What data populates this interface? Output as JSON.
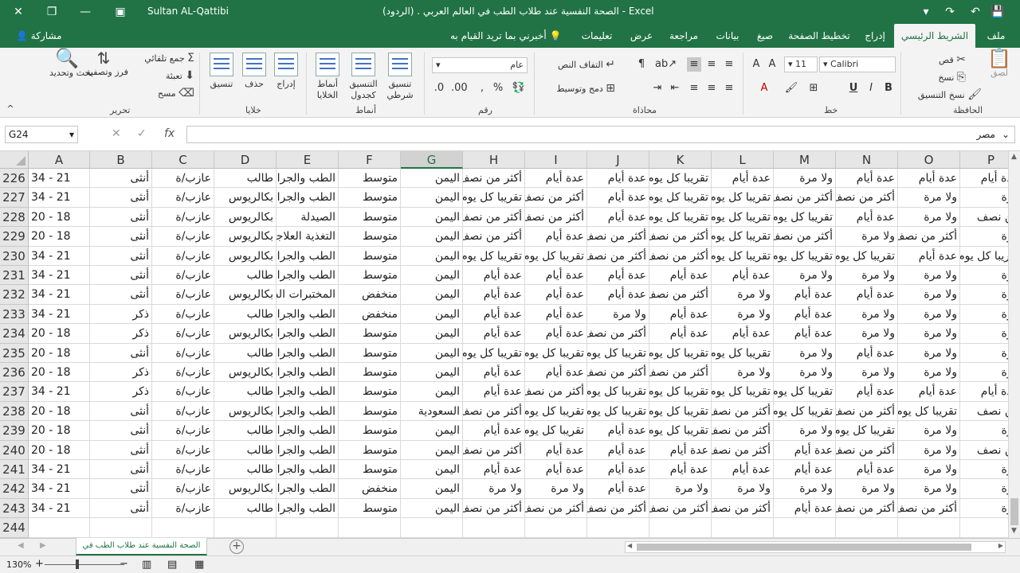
{
  "titlebar": {
    "user": "Sultan AL-Qattibi",
    "title": "الصحة النفسية عند طلاب الطب في العالم العربي .  (الردود)  -  Excel"
  },
  "tabs": {
    "file": "ملف",
    "home": "الشريط الرئيسي",
    "insert": "إدراج",
    "layout": "تخطيط الصفحة",
    "formulas": "صيغ",
    "data": "بيانات",
    "review": "مراجعة",
    "view": "عرض",
    "help": "تعليمات",
    "tellme": "أخبرني بما تريد القيام به",
    "share": "مشاركة"
  },
  "ribbon": {
    "clipboard": {
      "label": "الحافظة",
      "paste": "لصق",
      "cut": "قص",
      "copy": "نسخ",
      "format_painter": "نسخ التنسيق"
    },
    "font": {
      "label": "خط",
      "name": "Calibri",
      "size": "11",
      "bold": "B",
      "italic": "I",
      "underline": "U"
    },
    "alignment": {
      "label": "محاذاة",
      "wrap": "التفاف النص",
      "merge": "دمج وتوسيط"
    },
    "number": {
      "label": "رقم",
      "format": "عام"
    },
    "styles": {
      "label": "أنماط",
      "conditional": "تنسيق شرطي",
      "table": "التنسيق كجدول",
      "cell_styles": "أنماط الخلايا"
    },
    "cells": {
      "label": "خلايا",
      "insert": "إدراج",
      "delete": "حذف",
      "format": "تنسيق"
    },
    "editing": {
      "label": "تحرير",
      "autosum": "جمع تلقائي",
      "fill": "تعبئة",
      "clear": "مسح",
      "sort": "فرز وتصفية",
      "find": "بحث وتحديد"
    }
  },
  "formula_bar": {
    "name_box": "G24",
    "value": "مصر"
  },
  "columns": [
    "A",
    "B",
    "C",
    "D",
    "E",
    "F",
    "G",
    "H",
    "I",
    "J",
    "K",
    "L",
    "M",
    "N",
    "O",
    "P"
  ],
  "selected_column": "G",
  "rows": [
    {
      "n": "226",
      "c": [
        "34 - 21",
        "أنثى",
        "عازب/ة",
        "طالب",
        "الطب والجراحة",
        "متوسط",
        "اليمن",
        "أكثر من نصف",
        "عدة أيام",
        "عدة أيام",
        "تقريبا كل يوم",
        "عدة أيام",
        "ولا مرة",
        "عدة أيام",
        "عدة أيام",
        "عدة أيام"
      ]
    },
    {
      "n": "227",
      "c": [
        "34 - 21",
        "أنثى",
        "عازب/ة",
        "بكالريوس",
        "الطب والجراحة",
        "متوسط",
        "اليمن",
        "تقريبا كل يوم",
        "أكثر من نصف",
        "عدة أيام",
        "تقريبا كل يوم",
        "تقريبا كل يوم",
        "أكثر من نصف",
        "أكثر من نصف",
        "ولا مرة",
        "مرة"
      ]
    },
    {
      "n": "228",
      "c": [
        "20 - 18",
        "أنثى",
        "عازب/ة",
        "بكالريوس",
        "الصيدلة",
        "متوسط",
        "اليمن",
        "أكثر من نصف",
        "أكثر من نصف",
        "عدة أيام",
        "تقريبا كل يوم",
        "تقريبا كل يوم",
        "تقريبا كل يوم",
        "عدة أيام",
        "ولا مرة",
        "من نصف"
      ]
    },
    {
      "n": "229",
      "c": [
        "20 - 18",
        "أنثى",
        "عازب/ة",
        "بكالريوس",
        "التغذية العلاجية",
        "متوسط",
        "اليمن",
        "أكثر من نصف",
        "عدة أيام",
        "أكثر من نصف",
        "أكثر من نصف",
        "تقريبا كل يوم",
        "أكثر من نصف",
        "ولا مرة",
        "أكثر من نصف",
        "مرة"
      ]
    },
    {
      "n": "230",
      "c": [
        "34 - 21",
        "أنثى",
        "عازب/ة",
        "بكالريوس",
        "الطب والجراحة",
        "متوسط",
        "اليمن",
        "تقريبا كل يوم",
        "تقريبا كل يوم",
        "أكثر من نصف",
        "أكثر من نصف",
        "تقريبا كل يوم",
        "تقريبا كل يوم",
        "تقريبا كل يوم",
        "عدة أيام",
        "تقريبا كل يوم"
      ]
    },
    {
      "n": "231",
      "c": [
        "34 - 21",
        "أنثى",
        "عازب/ة",
        "طالب",
        "الطب والجراحة",
        "متوسط",
        "اليمن",
        "عدة أيام",
        "عدة أيام",
        "عدة أيام",
        "عدة أيام",
        "عدة أيام",
        "ولا مرة",
        "ولا مرة",
        "ولا مرة",
        "مرة"
      ]
    },
    {
      "n": "232",
      "c": [
        "34 - 21",
        "أنثى",
        "عازب/ة",
        "بكالريوس",
        "المختبرات الطبية",
        "منخفض",
        "اليمن",
        "عدة أيام",
        "عدة أيام",
        "عدة أيام",
        "أكثر من نصف",
        "ولا مرة",
        "عدة أيام",
        "عدة أيام",
        "ولا مرة",
        "مرة"
      ]
    },
    {
      "n": "233",
      "c": [
        "34 - 21",
        "ذكر",
        "عازب/ة",
        "طالب",
        "الطب والجراحة",
        "منخفض",
        "اليمن",
        "عدة أيام",
        "عدة أيام",
        "ولا مرة",
        "عدة أيام",
        "ولا مرة",
        "عدة أيام",
        "ولا مرة",
        "ولا مرة",
        "مرة"
      ]
    },
    {
      "n": "234",
      "c": [
        "20 - 18",
        "ذكر",
        "عازب/ة",
        "بكالريوس",
        "الطب والجراحة",
        "متوسط",
        "اليمن",
        "عدة أيام",
        "عدة أيام",
        "أكثر من نصف",
        "عدة أيام",
        "عدة أيام",
        "عدة أيام",
        "ولا مرة",
        "ولا مرة",
        "مرة"
      ]
    },
    {
      "n": "235",
      "c": [
        "20 - 18",
        "أنثى",
        "عازب/ة",
        "طالب",
        "الطب والجراحة",
        "متوسط",
        "اليمن",
        "تقريبا كل يوم",
        "تقريبا كل يوم",
        "تقريبا كل يوم",
        "تقريبا كل يوم",
        "تقريبا كل يوم",
        "ولا مرة",
        "عدة أيام",
        "ولا مرة",
        "مرة"
      ]
    },
    {
      "n": "236",
      "c": [
        "20 - 18",
        "ذكر",
        "عازب/ة",
        "بكالريوس",
        "الطب والجراحة",
        "متوسط",
        "اليمن",
        "عدة أيام",
        "عدة أيام",
        "أكثر من نصف",
        "أكثر من نصف",
        "ولا مرة",
        "ولا مرة",
        "ولا مرة",
        "ولا مرة",
        "مرة"
      ]
    },
    {
      "n": "237",
      "c": [
        "34 - 21",
        "ذكر",
        "عازب/ة",
        "طالب",
        "الطب والجراحة",
        "متوسط",
        "اليمن",
        "عدة أيام",
        "أكثر من نصف",
        "تقريبا كل يوم",
        "تقريبا كل يوم",
        "تقريبا كل يوم",
        "تقريبا كل يوم",
        "عدة أيام",
        "عدة أيام",
        "عدة أيام"
      ]
    },
    {
      "n": "238",
      "c": [
        "20 - 18",
        "أنثى",
        "عازب/ة",
        "بكالريوس",
        "الطب والجراحة",
        "متوسط",
        "السعودية",
        "أكثر من نصف",
        "تقريبا كل يوم",
        "تقريبا كل يوم",
        "تقريبا كل يوم",
        "أكثر من نصف",
        "تقريبا كل يوم",
        "أكثر من نصف",
        "تقريبا كل يوم",
        "من نصف"
      ]
    },
    {
      "n": "239",
      "c": [
        "20 - 18",
        "أنثى",
        "عازب/ة",
        "طالب",
        "الطب والجراحة",
        "متوسط",
        "اليمن",
        "عدة أيام",
        "تقريبا كل يوم",
        "عدة أيام",
        "تقريبا كل يوم",
        "أكثر من نصف",
        "ولا مرة",
        "تقريبا كل يوم",
        "ولا مرة",
        "مرة"
      ]
    },
    {
      "n": "240",
      "c": [
        "20 - 18",
        "أنثى",
        "عازب/ة",
        "طالب",
        "الطب والجراحة",
        "متوسط",
        "اليمن",
        "أكثر من نصف",
        "عدة أيام",
        "عدة أيام",
        "عدة أيام",
        "أكثر من نصف",
        "عدة أيام",
        "أكثر من نصف",
        "ولا مرة",
        "من نصف"
      ]
    },
    {
      "n": "241",
      "c": [
        "34 - 21",
        "أنثى",
        "عازب/ة",
        "طالب",
        "الطب والجراحة",
        "متوسط",
        "اليمن",
        "عدة أيام",
        "عدة أيام",
        "عدة أيام",
        "عدة أيام",
        "عدة أيام",
        "عدة أيام",
        "عدة أيام",
        "ولا مرة",
        "مرة"
      ]
    },
    {
      "n": "242",
      "c": [
        "34 - 21",
        "أنثى",
        "عازب/ة",
        "بكالريوس",
        "الطب والجراحة",
        "منخفض",
        "اليمن",
        "ولا مرة",
        "ولا مرة",
        "عدة أيام",
        "ولا مرة",
        "ولا مرة",
        "ولا مرة",
        "ولا مرة",
        "ولا مرة",
        "مرة"
      ]
    },
    {
      "n": "243",
      "c": [
        "34 - 21",
        "أنثى",
        "عازب/ة",
        "طالب",
        "الطب والجراحة",
        "متوسط",
        "اليمن",
        "أكثر من نصف",
        "أكثر من نصف",
        "أكثر من نصف",
        "أكثر من نصف",
        "أكثر من نصف",
        "عدة أيام",
        "أكثر من نصف",
        "أكثر من نصف",
        "مرة"
      ]
    },
    {
      "n": "244",
      "c": [
        "",
        "",
        "",
        "",
        "",
        "",
        "",
        "",
        "",
        "",
        "",
        "",
        "",
        "",
        "",
        ""
      ]
    }
  ],
  "sheet_tab": "الصحة النفسية عند طلاب الطب في",
  "statusbar": {
    "zoom": "130%"
  }
}
